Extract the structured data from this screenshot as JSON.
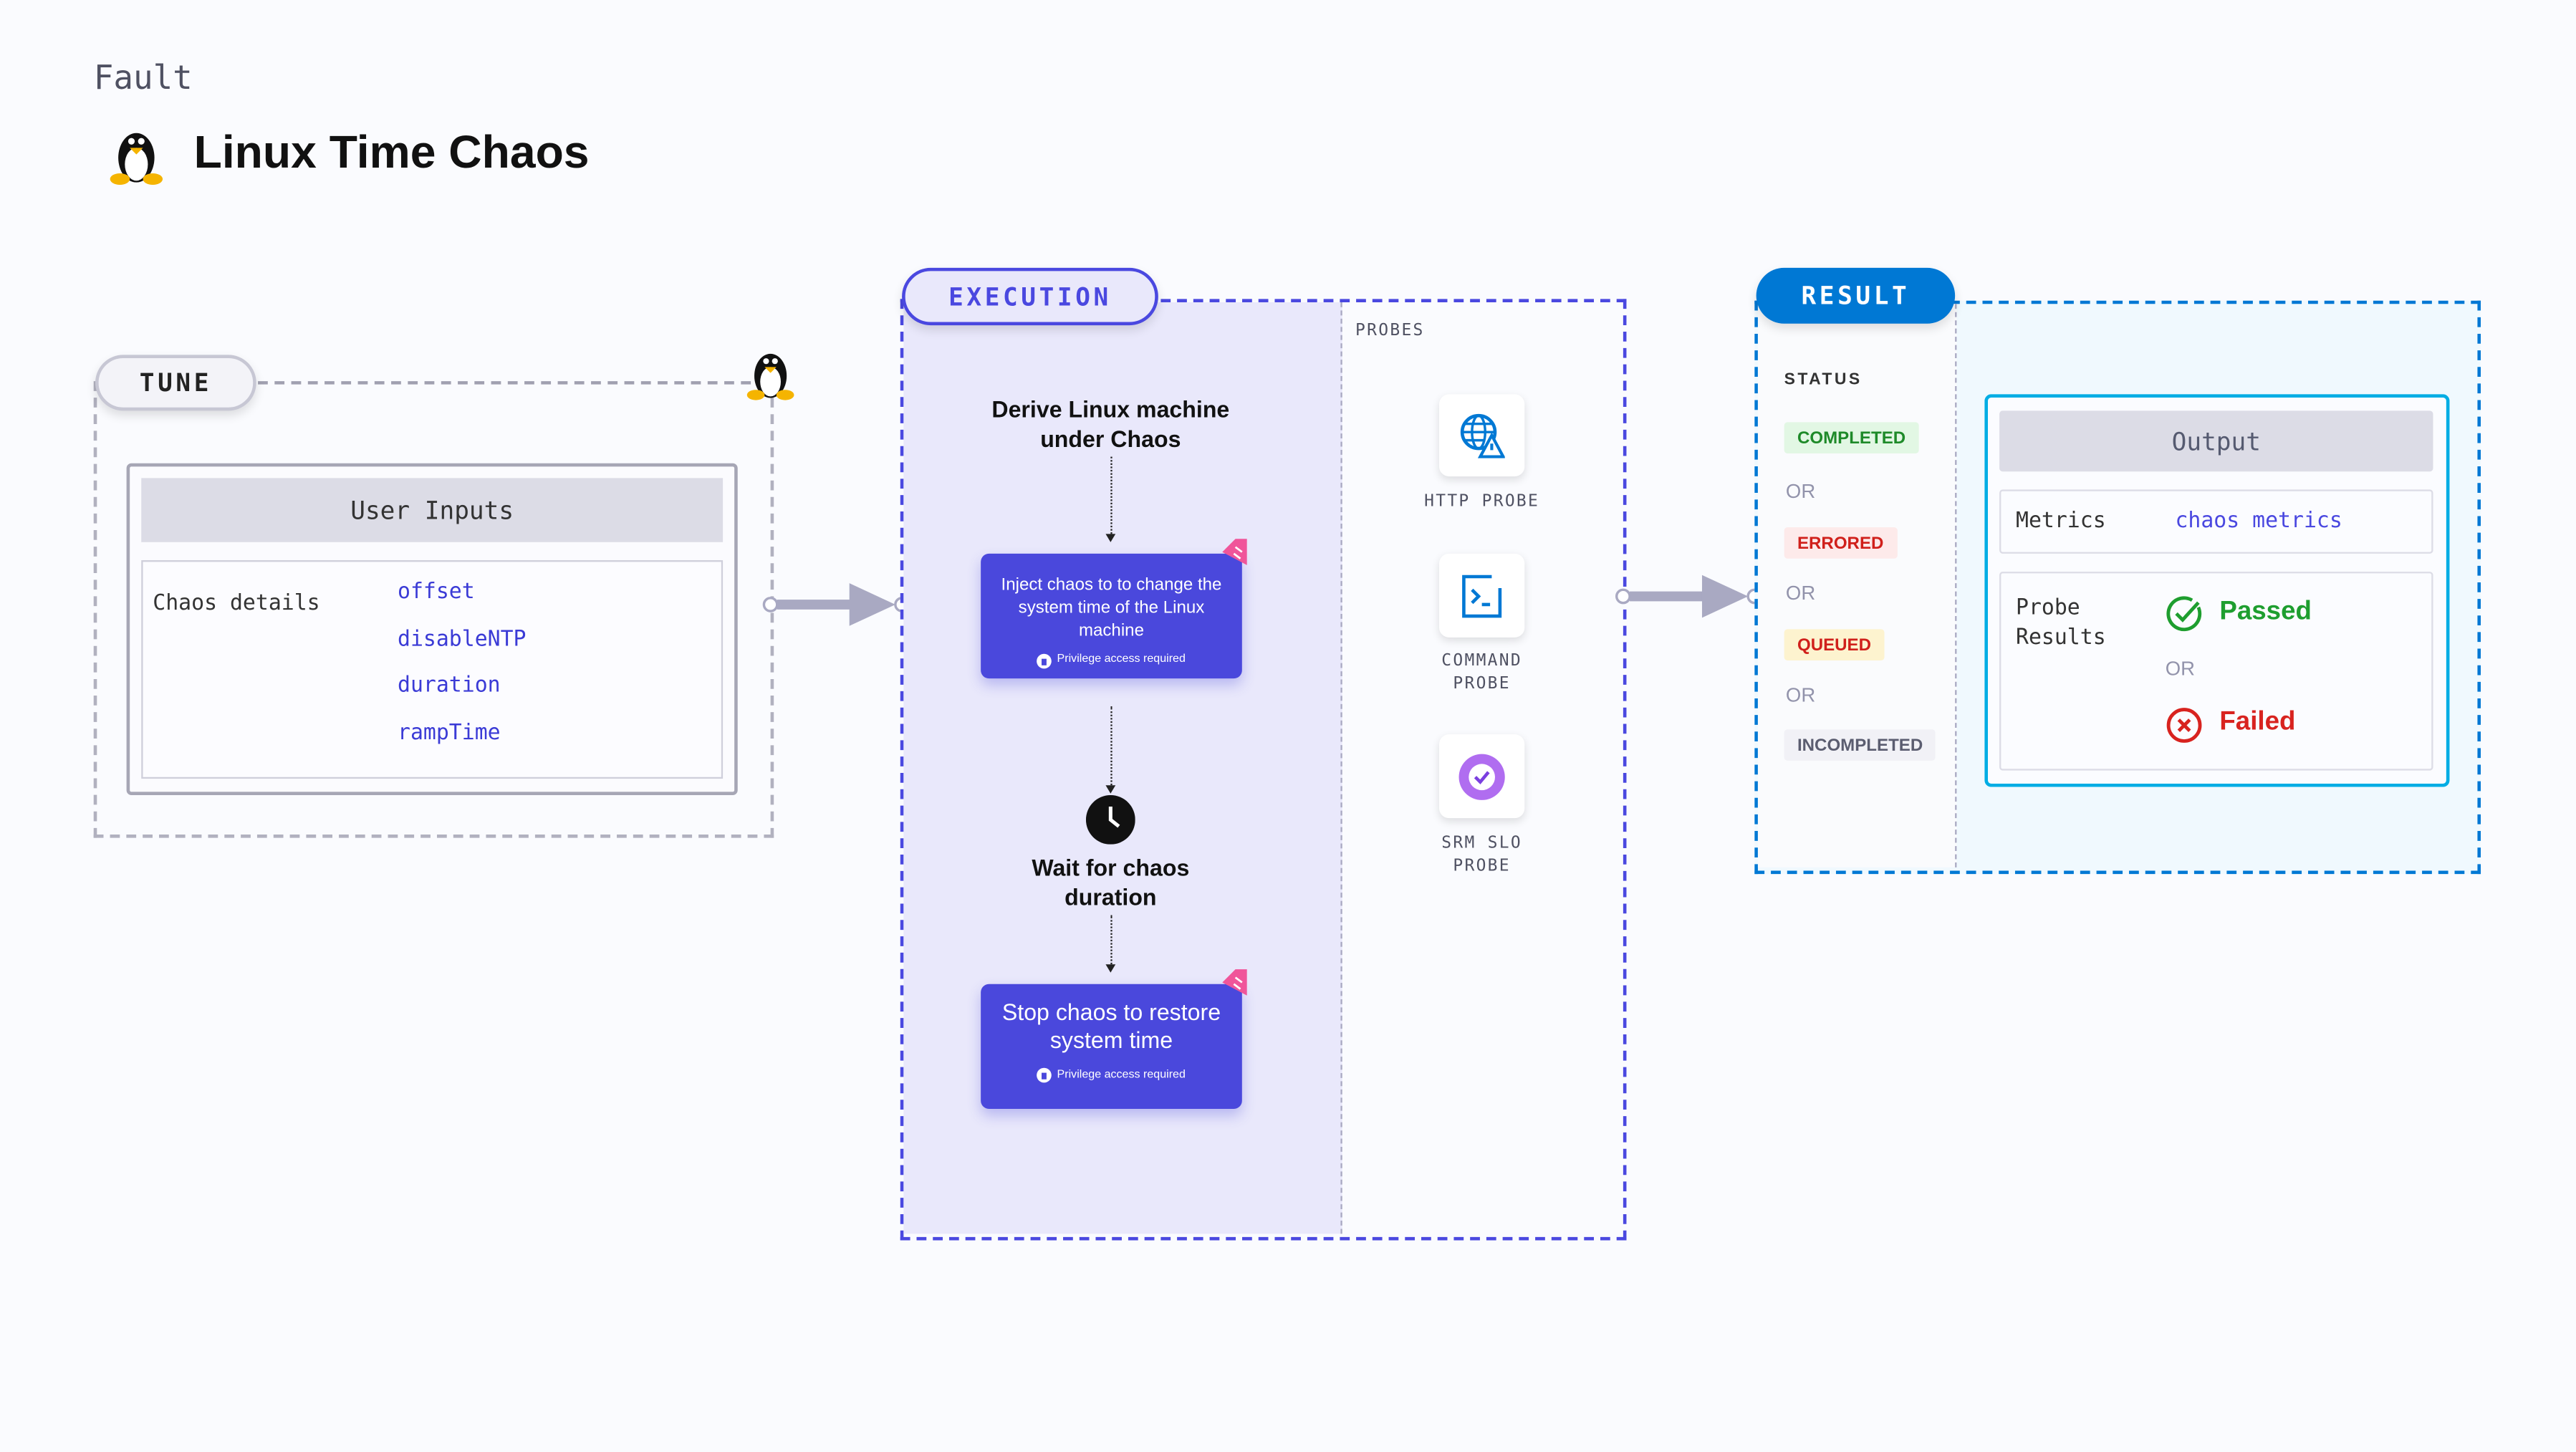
{
  "header": {
    "kind": "Fault",
    "title": "Linux Time Chaos",
    "icon": "linux-penguin-icon"
  },
  "tune": {
    "label": "TUNE",
    "panel_title": "User Inputs",
    "row_label": "Chaos details",
    "inputs": [
      "offset",
      "disableNTP",
      "duration",
      "rampTime"
    ]
  },
  "execution": {
    "label": "EXECUTION",
    "step_derive": "Derive Linux machine under Chaos",
    "step_inject": "Inject chaos to to change the system time of the Linux machine",
    "step_wait": "Wait for chaos duration",
    "step_stop": "Stop chaos to restore system time",
    "privilege": "Privilege access required",
    "probes_label": "PROBES",
    "probes": [
      {
        "name": "HTTP PROBE",
        "icon": "globe-warning-icon"
      },
      {
        "name": "COMMAND PROBE",
        "icon": "terminal-icon"
      },
      {
        "name": "SRM SLO PROBE",
        "icon": "slo-icon"
      }
    ]
  },
  "result": {
    "label": "RESULT",
    "status_label": "STATUS",
    "or": "OR",
    "statuses": [
      {
        "label": "COMPLETED",
        "color": "#1e8a29",
        "bg": "#e2f7e4"
      },
      {
        "label": "ERRORED",
        "color": "#d0201b",
        "bg": "#fdeaea"
      },
      {
        "label": "QUEUED",
        "color": "#d0201b",
        "bg": "#fdf3cf"
      },
      {
        "label": "INCOMPLETED",
        "color": "#5b5d70",
        "bg": "#f1f1f6"
      }
    ],
    "output_title": "Output",
    "metrics_label": "Metrics",
    "metrics_value": "chaos metrics",
    "probe_results_label": "Probe Results",
    "passed": "Passed",
    "failed": "Failed"
  },
  "colors": {
    "execution": "#4a48e0",
    "result": "#0078d4",
    "output_border": "#00ade4",
    "passed": "#1e9e2f",
    "failed": "#d8231f"
  }
}
